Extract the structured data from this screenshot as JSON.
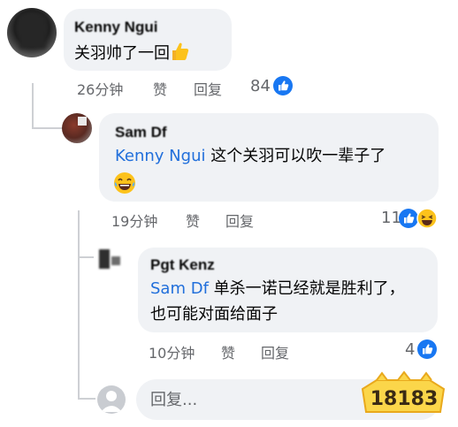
{
  "comment_1": {
    "author": "Kenny Ngui",
    "text": "关羽帅了一回",
    "emoji": "thumbs-up",
    "time": "26分钟",
    "like_label": "赞",
    "reply_label": "回复",
    "reaction_count": "84"
  },
  "comment_2": {
    "author": "Sam Df",
    "mention": "Kenny Ngui",
    "text": "这个关羽可以吹一辈子了",
    "emoji": "laughing-face",
    "time": "19分钟",
    "like_label": "赞",
    "reply_label": "回复",
    "reaction_count": "11"
  },
  "comment_3": {
    "author": "Pgt Kenz",
    "mention": "Sam Df",
    "text": "单杀一诺已经就是胜利了，也可能对面给面子",
    "time": "10分钟",
    "like_label": "赞",
    "reply_label": "回复",
    "reaction_count": "4"
  },
  "composer": {
    "placeholder": "回复..."
  },
  "watermark": {
    "text": "18183"
  },
  "colors": {
    "bubble": "#f0f2f5",
    "meta_text": "#65676b",
    "mention": "#216fdb",
    "like_blue": "#1877f2",
    "thread_line": "#ced0d4"
  }
}
